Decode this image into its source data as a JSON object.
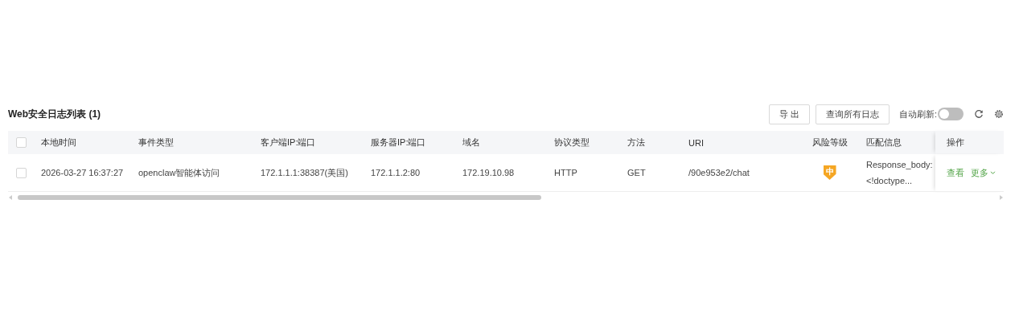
{
  "title": "Web安全日志列表 (1)",
  "toolbar": {
    "buttons": [
      "导 出",
      "查询所有日志"
    ],
    "auto_refresh": {
      "label": "自动刷新:",
      "on": false
    }
  },
  "table": {
    "header_checked": false,
    "columns": [
      "本地时间",
      "事件类型",
      "客户端IP:端口",
      "服务器IP:端口",
      "域名",
      "协议类型",
      "方法",
      "URI",
      "风险等级",
      "匹配信息",
      "操作"
    ],
    "rows": [
      {
        "checked": false,
        "time": "2026-03-27 16:37:27",
        "event_type": "openclaw智能体访问",
        "client": "172.1.1.1:38387(美国)",
        "server": "172.1.1.2:80",
        "domain": "172.19.10.98",
        "protocol": "HTTP",
        "method": "GET",
        "uri": "/90e953e2/chat",
        "risk": {
          "label": "中",
          "color": "#f5a623"
        },
        "match": [
          "Response_body:",
          "<!doctype..."
        ],
        "actions": [
          "查看",
          "更多"
        ]
      }
    ]
  }
}
